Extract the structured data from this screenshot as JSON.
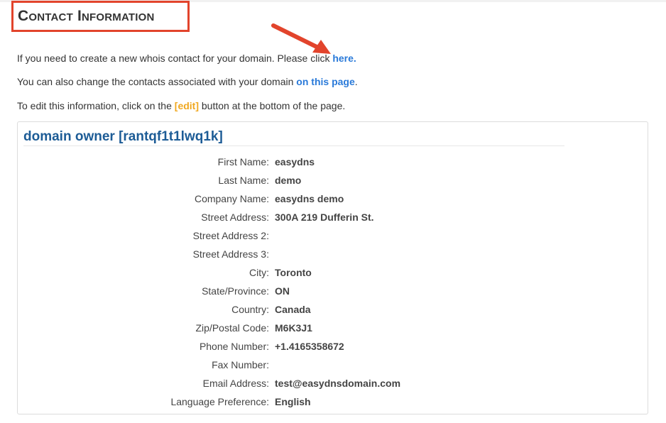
{
  "header": {
    "title": "Contact Information"
  },
  "intro": {
    "p1_text": "If you need to create a new whois contact for your domain. Please click ",
    "p1_link": "here.",
    "p2_text": "You can also change the contacts associated with your domain ",
    "p2_link": "on this page",
    "p2_end": ".",
    "p3_before": "To edit this information, click on the ",
    "p3_edit": "[edit]",
    "p3_after": " button at the bottom of the page."
  },
  "panel": {
    "title": "domain owner [rantqf1t1lwq1k]",
    "fields": [
      {
        "label": "First Name:",
        "value": "easydns"
      },
      {
        "label": "Last Name:",
        "value": "demo"
      },
      {
        "label": "Company Name:",
        "value": "easydns demo"
      },
      {
        "label": "Street Address:",
        "value": "300A 219 Dufferin St."
      },
      {
        "label": "Street Address 2:",
        "value": ""
      },
      {
        "label": "Street Address 3:",
        "value": ""
      },
      {
        "label": "City:",
        "value": "Toronto"
      },
      {
        "label": "State/Province:",
        "value": "ON"
      },
      {
        "label": "Country:",
        "value": "Canada"
      },
      {
        "label": "Zip/Postal Code:",
        "value": "M6K3J1"
      },
      {
        "label": "Phone Number:",
        "value": "+1.4165358672"
      },
      {
        "label": "Fax Number:",
        "value": ""
      },
      {
        "label": "Email Address:",
        "value": "test@easydnsdomain.com"
      },
      {
        "label": "Language Preference:",
        "value": "English"
      }
    ]
  },
  "annotation": {
    "arrow_icon": "red-arrow-icon",
    "arrow_color": "#e2442c",
    "highlight_color": "#e2442c"
  },
  "colors": {
    "link": "#2a7ad9",
    "edit": "#f0a820",
    "panel_title": "#1d5c96"
  }
}
